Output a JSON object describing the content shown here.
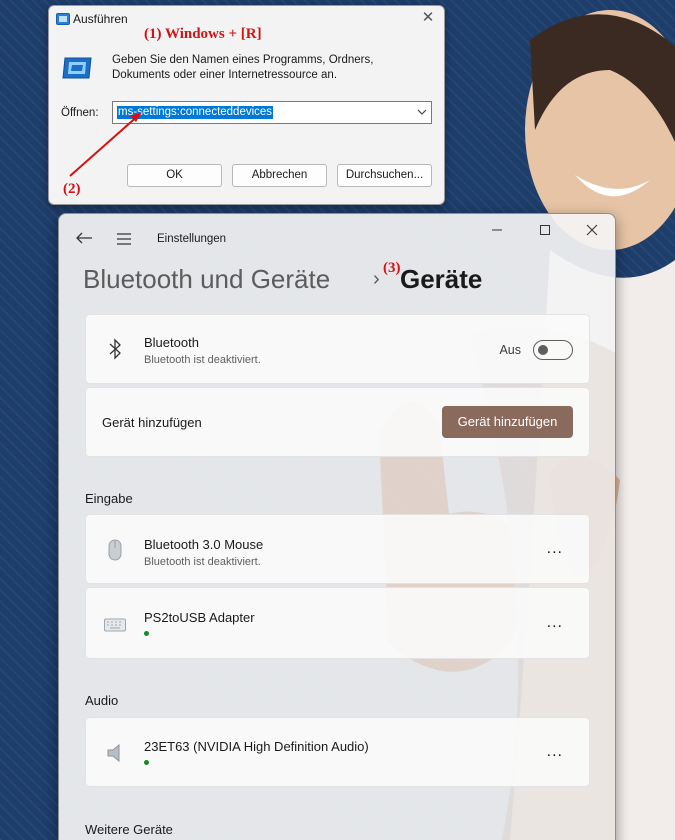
{
  "run_dialog": {
    "title": "Ausführen",
    "close_glyph": "✕",
    "annotation_1": "(1)    Windows + [R]",
    "description": "Geben Sie den Namen eines Programms, Ordners, Dokuments oder einer Internetressource an.",
    "open_label": "Öffnen:",
    "open_value": "ms-settings:connecteddevices",
    "ok_label": "OK",
    "cancel_label": "Abbrechen",
    "browse_label": "Durchsuchen...",
    "annotation_2": "(2)",
    "annotation_color": "#d81010"
  },
  "settings": {
    "window_title": "Einstellungen",
    "breadcrumb_parent": "Bluetooth und Geräte",
    "breadcrumb_separator": "›",
    "annotation_3": "(3)",
    "breadcrumb_current": "Geräte",
    "bluetooth_card": {
      "title": "Bluetooth",
      "subtitle": "Bluetooth ist deaktiviert.",
      "toggle_state_label": "Aus",
      "toggle_on": false
    },
    "add_device_card": {
      "label": "Gerät hinzufügen",
      "button_label": "Gerät hinzufügen",
      "button_color": "#8b6a5e"
    },
    "input_section": {
      "label": "Eingabe",
      "devices": [
        {
          "name": "Bluetooth 3.0 Mouse",
          "status": "Bluetooth ist deaktiviert.",
          "icon": "mouse-icon",
          "more": "..."
        },
        {
          "name": "PS2toUSB Adapter",
          "status": "",
          "icon": "keyboard-icon",
          "connected": true,
          "more": "..."
        }
      ]
    },
    "audio_section": {
      "label": "Audio",
      "devices": [
        {
          "name": "23ET63 (NVIDIA High Definition Audio)",
          "icon": "speaker-icon",
          "connected": true,
          "more": "..."
        }
      ]
    },
    "other_section": {
      "label": "Weitere Geräte"
    }
  }
}
